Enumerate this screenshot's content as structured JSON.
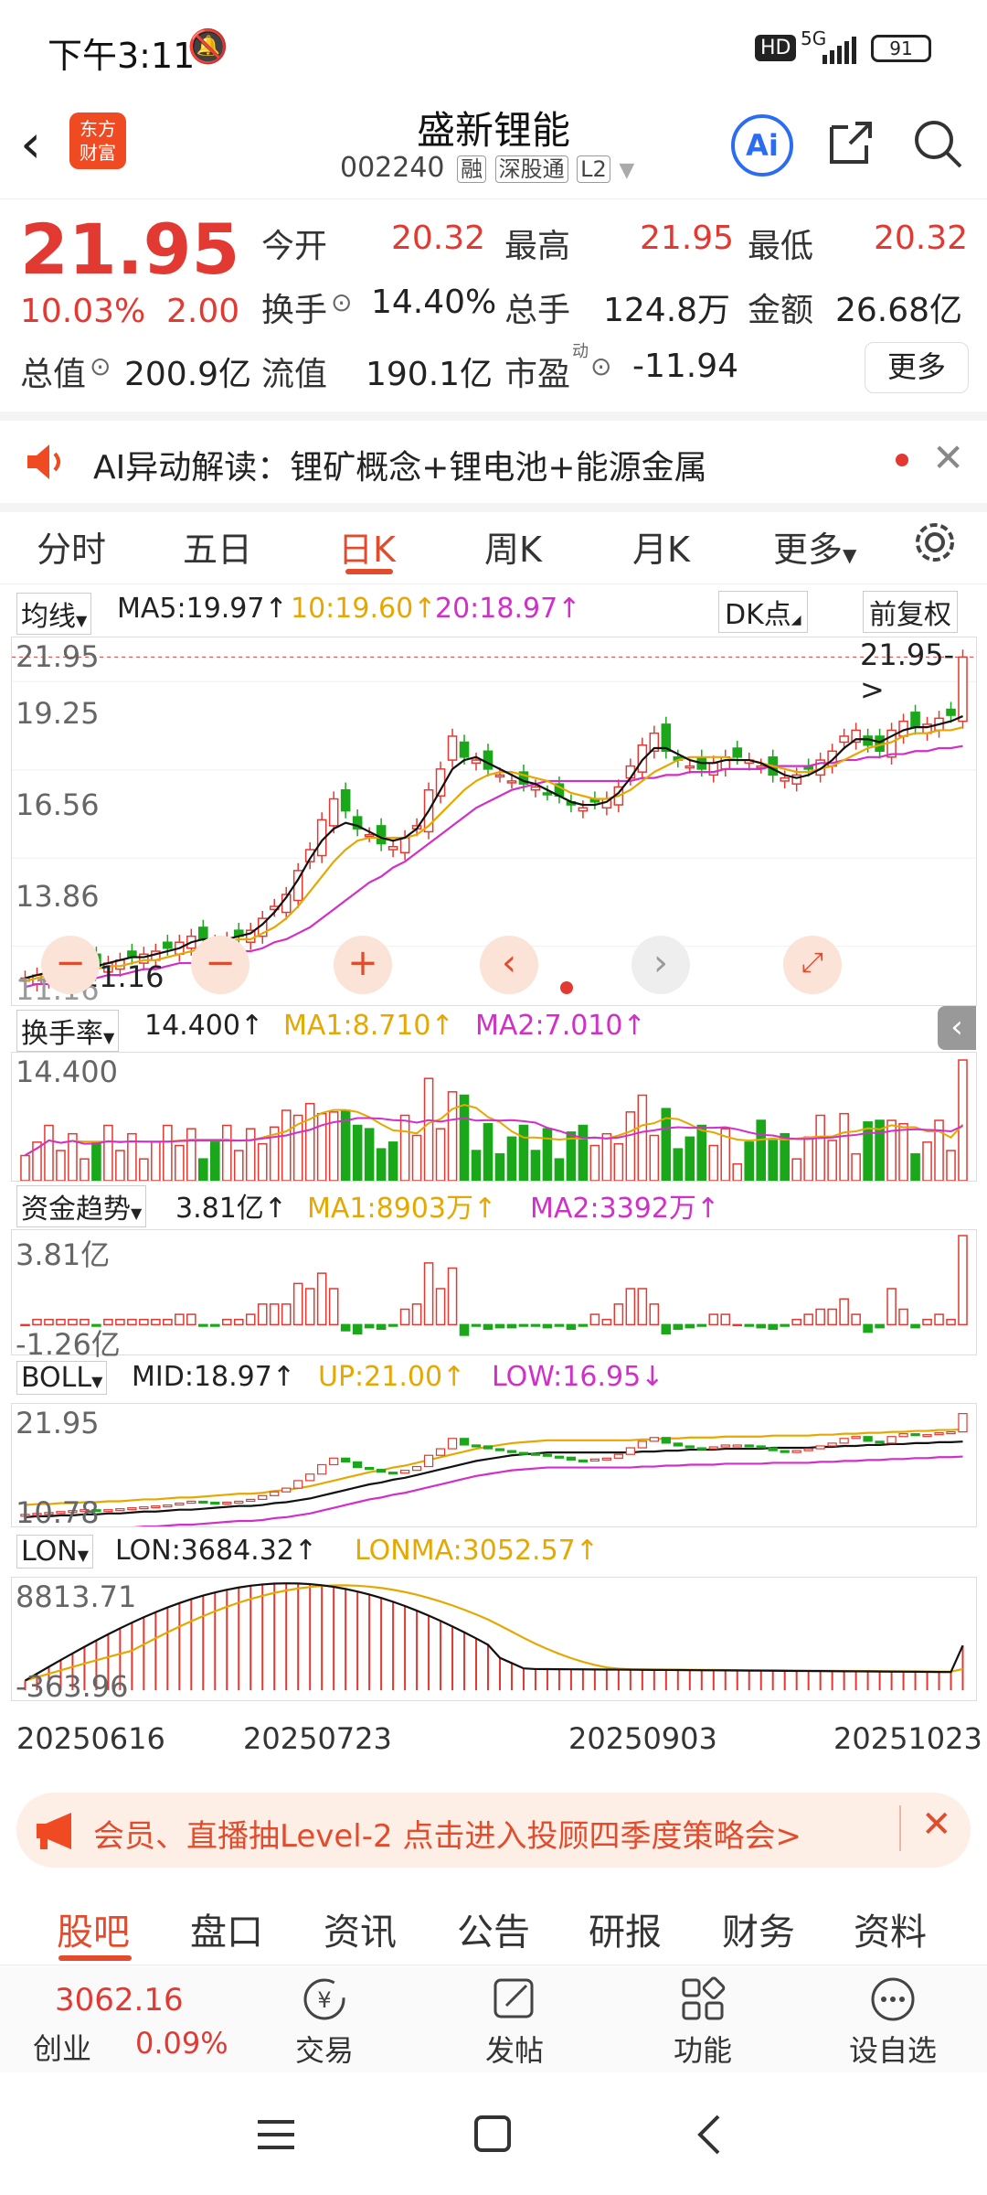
{
  "status": {
    "time": "下午3:11",
    "hd": "HD",
    "net": "5G",
    "battery": "91"
  },
  "header": {
    "title": "盛新锂能",
    "code": "002240",
    "badges": [
      "融",
      "深股通",
      "L2"
    ],
    "logo_top": "东方",
    "logo_bottom": "财富",
    "ai_label": "Ai"
  },
  "quote": {
    "price": "21.95",
    "change_pct": "10.03%",
    "change": "2.00",
    "open_label": "今开",
    "open": "20.32",
    "high_label": "最高",
    "high": "21.95",
    "low_label": "最低",
    "low": "20.32",
    "turnover_label": "换手",
    "turnover": "14.40%",
    "volume_label": "总手",
    "volume": "124.8万",
    "amount_label": "金额",
    "amount": "26.68亿",
    "mcap_label": "总值",
    "mcap": "200.9亿",
    "float_label": "流值",
    "float": "190.1亿",
    "pe_label": "市盈",
    "pe_sup": "动",
    "pe": "-11.94",
    "more": "更多"
  },
  "ai_banner": {
    "text": "AI异动解读：锂矿概念+锂电池+能源金属"
  },
  "period_tabs": [
    "分时",
    "五日",
    "日K",
    "周K",
    "月K",
    "更多"
  ],
  "active_tab": "日K",
  "kline": {
    "indicator": "均线",
    "ma5": "MA5:19.97",
    "ma10": "10:19.60",
    "ma20": "20:18.97",
    "dk": "DK点",
    "adjust": "前复权",
    "yticks": [
      "21.95",
      "19.25",
      "16.56",
      "13.86"
    ],
    "last_tag": "21.95->",
    "low_tag": "11.16",
    "bottom_tick": "11.16"
  },
  "turnover_panel": {
    "name": "换手率",
    "value": "14.400",
    "ma1": "MA1:8.710",
    "ma2": "MA2:7.010",
    "ytop": "14.400"
  },
  "fund_panel": {
    "name": "资金趋势",
    "value": "3.81亿",
    "ma1": "MA1:8903万",
    "ma2": "MA2:3392万",
    "ytop": "3.81亿",
    "ybot": "-1.26亿"
  },
  "boll_panel": {
    "name": "BOLL",
    "mid": "MID:18.97",
    "up": "UP:21.00",
    "low": "LOW:16.95",
    "ytop": "21.95",
    "ybot": "10.78"
  },
  "lon_panel": {
    "name": "LON",
    "lon": "LON:3684.32",
    "lonma": "LONMA:3052.57",
    "ytop": "8813.71",
    "ybot": "-363.96"
  },
  "dates": [
    "20250616",
    "20250723",
    "20250903",
    "20251023"
  ],
  "promo": {
    "text": "会员、直播抽Level-2 点击进入投顾四季度策略会>"
  },
  "bottom_tabs": [
    "股吧",
    "盘口",
    "资讯",
    "公告",
    "研报",
    "财务",
    "资料"
  ],
  "active_bottom_tab": "股吧",
  "bottom_nav": {
    "index_value": "3062.16",
    "index_name": "创业",
    "index_change": "0.09%",
    "trade": "交易",
    "post": "发帖",
    "func": "功能",
    "watch": "设自选"
  },
  "colors": {
    "up": "#e23a32",
    "down": "#1aa81a",
    "ma10": "#e6a800",
    "ma20": "#d22fc8",
    "accent": "#e24c2c"
  },
  "chart_data": {
    "type": "candlestick",
    "close": [
      11.2,
      11.3,
      11.4,
      11.5,
      11.6,
      11.7,
      11.6,
      11.7,
      11.8,
      11.9,
      12.0,
      12.1,
      12.2,
      12.4,
      12.6,
      12.5,
      12.4,
      12.5,
      12.6,
      12.8,
      13.2,
      13.6,
      14.0,
      14.8,
      15.5,
      16.5,
      17.2,
      16.8,
      16.2,
      16.0,
      15.7,
      15.6,
      15.9,
      16.3,
      17.5,
      18.2,
      19.3,
      18.6,
      18.5,
      18.2,
      18.0,
      17.8,
      17.7,
      17.6,
      17.4,
      17.3,
      17.0,
      16.9,
      17.1,
      17.2,
      17.6,
      18.3,
      19.0,
      19.4,
      18.8,
      18.5,
      18.3,
      18.2,
      18.4,
      18.6,
      18.6,
      18.5,
      18.3,
      18.0,
      17.9,
      18.0,
      18.2,
      18.5,
      18.8,
      19.3,
      19.5,
      19.0,
      18.8,
      19.5,
      19.8,
      19.6,
      19.7,
      19.9,
      20.0,
      21.95
    ],
    "ma5": [
      11.2,
      11.3,
      11.4,
      11.5,
      11.6,
      11.6,
      11.6,
      11.7,
      11.8,
      11.9,
      11.9,
      12.0,
      12.1,
      12.2,
      12.4,
      12.5,
      12.5,
      12.5,
      12.6,
      12.7,
      13.0,
      13.4,
      13.9,
      14.5,
      15.2,
      15.8,
      16.2,
      16.4,
      16.3,
      16.1,
      15.9,
      15.8,
      15.9,
      16.2,
      16.8,
      17.5,
      18.2,
      18.5,
      18.6,
      18.4,
      18.2,
      18.0,
      17.8,
      17.7,
      17.5,
      17.3,
      17.1,
      17.0,
      17.0,
      17.1,
      17.4,
      17.9,
      18.5,
      18.9,
      18.9,
      18.7,
      18.5,
      18.4,
      18.4,
      18.5,
      18.5,
      18.5,
      18.4,
      18.2,
      18.0,
      17.9,
      18.0,
      18.2,
      18.5,
      18.9,
      19.2,
      19.2,
      19.1,
      19.3,
      19.5,
      19.6,
      19.6,
      19.7,
      19.8,
      19.97
    ],
    "ma10": [
      11.1,
      11.2,
      11.3,
      11.3,
      11.4,
      11.5,
      11.5,
      11.6,
      11.6,
      11.7,
      11.8,
      11.8,
      11.9,
      12.0,
      12.1,
      12.2,
      12.3,
      12.4,
      12.5,
      12.5,
      12.7,
      12.9,
      13.2,
      13.6,
      14.1,
      14.6,
      15.1,
      15.5,
      15.8,
      15.9,
      15.9,
      15.9,
      15.9,
      16.0,
      16.3,
      16.7,
      17.1,
      17.5,
      17.8,
      18.0,
      18.1,
      18.1,
      18.0,
      17.9,
      17.8,
      17.6,
      17.4,
      17.3,
      17.2,
      17.2,
      17.3,
      17.5,
      17.8,
      18.1,
      18.3,
      18.5,
      18.6,
      18.6,
      18.6,
      18.6,
      18.5,
      18.5,
      18.4,
      18.3,
      18.2,
      18.1,
      18.1,
      18.2,
      18.3,
      18.5,
      18.7,
      18.9,
      19.0,
      19.1,
      19.3,
      19.4,
      19.4,
      19.5,
      19.5,
      19.6
    ],
    "ma20": [
      10.9,
      11.0,
      11.0,
      11.1,
      11.1,
      11.2,
      11.2,
      11.3,
      11.3,
      11.4,
      11.5,
      11.5,
      11.6,
      11.7,
      11.7,
      11.8,
      11.9,
      12.0,
      12.1,
      12.1,
      12.2,
      12.4,
      12.5,
      12.7,
      12.9,
      13.2,
      13.5,
      13.8,
      14.1,
      14.4,
      14.6,
      14.9,
      15.1,
      15.4,
      15.7,
      16.0,
      16.3,
      16.6,
      16.9,
      17.1,
      17.3,
      17.5,
      17.6,
      17.7,
      17.8,
      17.8,
      17.8,
      17.8,
      17.8,
      17.8,
      17.8,
      17.8,
      17.9,
      17.9,
      18.0,
      18.0,
      18.1,
      18.1,
      18.1,
      18.2,
      18.2,
      18.2,
      18.2,
      18.3,
      18.3,
      18.3,
      18.3,
      18.4,
      18.4,
      18.5,
      18.5,
      18.6,
      18.6,
      18.7,
      18.7,
      18.8,
      18.8,
      18.9,
      18.9,
      18.97
    ]
  }
}
